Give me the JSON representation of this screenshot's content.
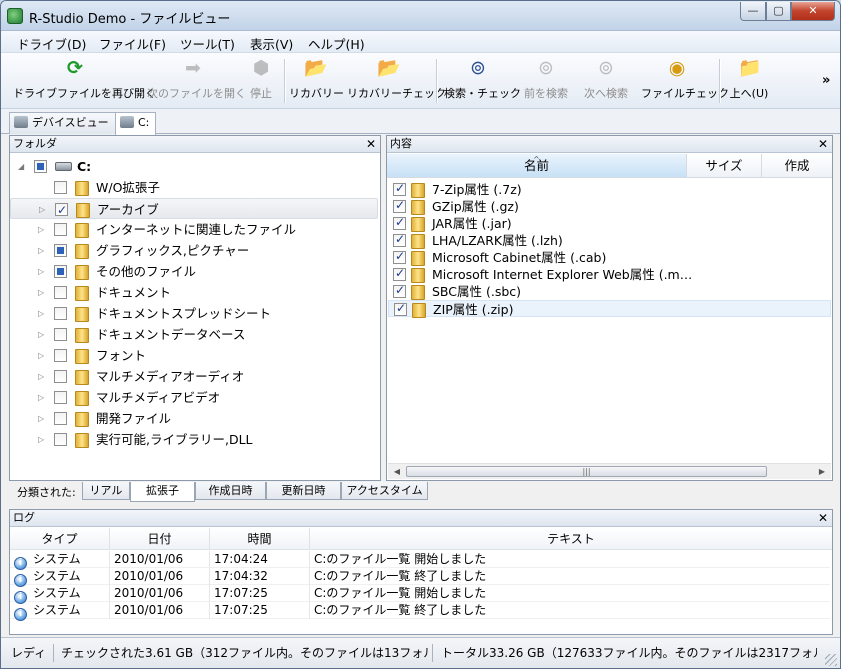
{
  "window": {
    "title": "R-Studio Demo - ファイルビュー",
    "min_label": "—",
    "max_label": "▢",
    "close_label": "✕"
  },
  "menu": [
    "ドライブ(D)",
    "ファイル(F)",
    "ツール(T)",
    "表示(V)",
    "ヘルプ(H)"
  ],
  "toolbar": {
    "buttons": [
      {
        "label": "ドライブファイルを再び開く",
        "icon": "refresh-icon"
      },
      {
        "label": "次のファイルを開く",
        "icon": "arrow-right-icon"
      },
      {
        "label": "停止",
        "icon": "stop-icon"
      },
      {
        "label": "リカバリー",
        "icon": "recover-icon"
      },
      {
        "label": "リカバリーチェック",
        "icon": "recover-check-icon"
      },
      {
        "label": "検索・チェック",
        "icon": "binoculars-icon"
      },
      {
        "label": "前を検索",
        "icon": "find-prev-icon"
      },
      {
        "label": "次へ検索",
        "icon": "find-next-icon"
      },
      {
        "label": "ファイルチェック",
        "icon": "file-check-icon"
      },
      {
        "label": "上へ(U)",
        "icon": "folder-up-icon"
      }
    ],
    "more": "»"
  },
  "view_tabs": [
    "デバイスビュー",
    "C:"
  ],
  "folders_panel": {
    "title": "フォルダ",
    "root": "C:",
    "items": [
      {
        "label": "W/O拡張子",
        "checked": "none"
      },
      {
        "label": "アーカイブ",
        "checked": "full"
      },
      {
        "label": "インターネットに関連したファイル",
        "checked": "none"
      },
      {
        "label": "グラフィックス,ピクチャー",
        "checked": "partial"
      },
      {
        "label": "その他のファイル",
        "checked": "partial"
      },
      {
        "label": "ドキュメント",
        "checked": "none"
      },
      {
        "label": "ドキュメントスプレッドシート",
        "checked": "none"
      },
      {
        "label": "ドキュメントデータベース",
        "checked": "none"
      },
      {
        "label": "フォント",
        "checked": "none"
      },
      {
        "label": "マルチメディアオーディオ",
        "checked": "none"
      },
      {
        "label": "マルチメディアビデオ",
        "checked": "none"
      },
      {
        "label": "開発ファイル",
        "checked": "none"
      },
      {
        "label": "実行可能,ライブラリー,DLL",
        "checked": "none"
      }
    ]
  },
  "contents_panel": {
    "title": "内容",
    "columns": [
      "名前",
      "サイズ",
      "作成"
    ],
    "items": [
      "7-Zip属性 (.7z)",
      "GZip属性 (.gz)",
      "JAR属性 (.jar)",
      "LHA/LZARK属性 (.lzh)",
      "Microsoft Cabinet属性 (.cab)",
      "Microsoft Internet Explorer Web属性 (.m…",
      "SBC属性 (.sbc)",
      "ZIP属性 (.zip)"
    ]
  },
  "classification": {
    "label": "分類された:",
    "tabs": [
      "リアル",
      "拡張子",
      "作成日時",
      "更新日時",
      "アクセスタイム"
    ]
  },
  "log_panel": {
    "title": "ログ",
    "columns": [
      "タイプ",
      "日付",
      "時間",
      "テキスト"
    ],
    "rows": [
      {
        "type": "システム",
        "date": "2010/01/06",
        "time": "17:04:24",
        "text": "C:のファイル一覧 開始しました"
      },
      {
        "type": "システム",
        "date": "2010/01/06",
        "time": "17:04:32",
        "text": "C:のファイル一覧 終了しました"
      },
      {
        "type": "システム",
        "date": "2010/01/06",
        "time": "17:07:25",
        "text": "C:のファイル一覧 開始しました"
      },
      {
        "type": "システム",
        "date": "2010/01/06",
        "time": "17:07:25",
        "text": "C:のファイル一覧 終了しました"
      }
    ]
  },
  "status": {
    "ready": "レディ",
    "checked": "チェックされた3.61 GB（312ファイル内。そのファイルは13フォル",
    "total": "トータル33.26 GB（127633ファイル内。そのファイルは2317フォル"
  }
}
